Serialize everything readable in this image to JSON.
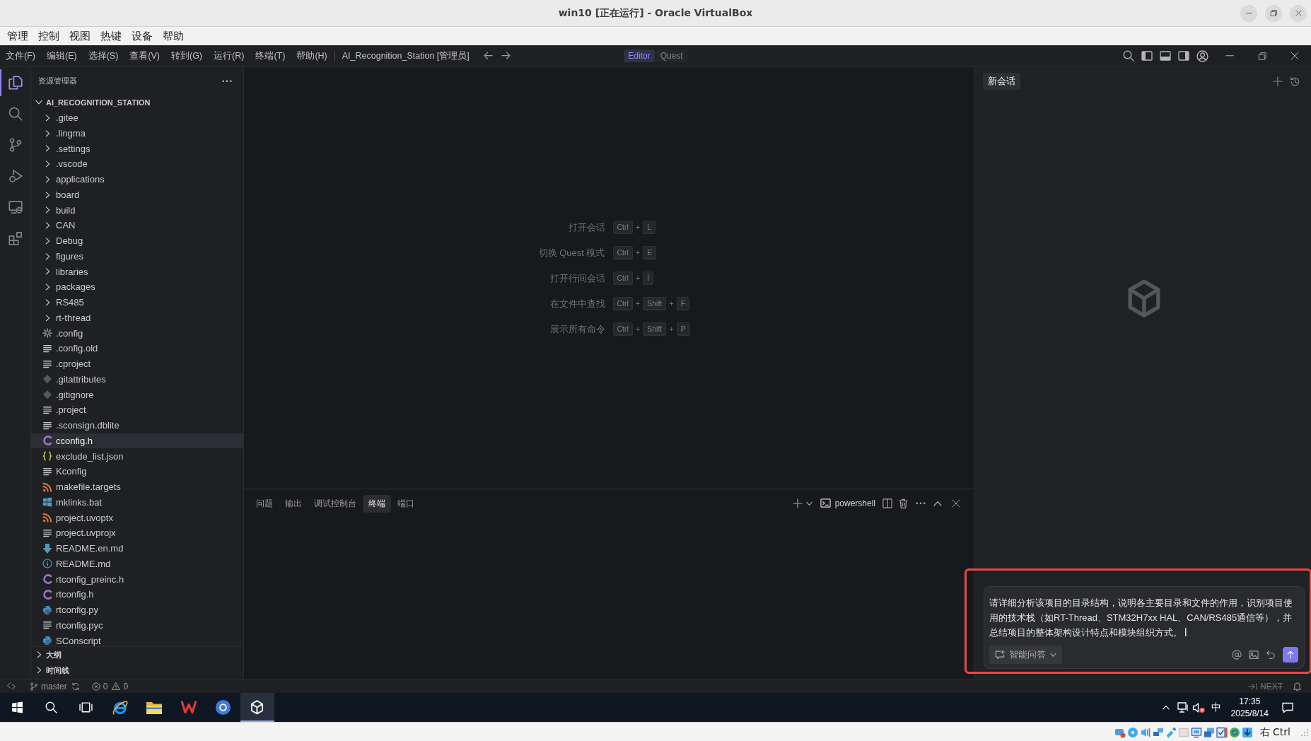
{
  "virtualbox": {
    "title": "win10 [正在运行] - Oracle VirtualBox",
    "menu": [
      "管理",
      "控制",
      "视图",
      "热键",
      "设备",
      "帮助"
    ],
    "host_key": "右 Ctrl"
  },
  "titlebar": {
    "menu": [
      "文件(F)",
      "编辑(E)",
      "选择(S)",
      "查看(V)",
      "转到(G)",
      "运行(R)",
      "终端(T)",
      "帮助(H)"
    ],
    "workspace": "AI_Recognition_Station [管理员]",
    "modes": [
      {
        "label": "Editor",
        "selected": true
      },
      {
        "label": "Quest",
        "selected": false
      }
    ]
  },
  "activity_bar": [
    {
      "kind": "explorer",
      "selected": true
    },
    {
      "kind": "search",
      "selected": false
    },
    {
      "kind": "source_control",
      "selected": false
    },
    {
      "kind": "run_debug",
      "selected": false
    },
    {
      "kind": "remote",
      "selected": false
    },
    {
      "kind": "extensions",
      "selected": false
    }
  ],
  "sidebar": {
    "title": "资源管理器",
    "root": {
      "label": "AI_RECOGNITION_STATION",
      "expanded": true
    },
    "folders": [
      {
        "label": ".gitee",
        "expanded": false,
        "selected": false
      },
      {
        "label": ".lingma",
        "expanded": false,
        "selected": false
      },
      {
        "label": ".settings",
        "expanded": false,
        "selected": false
      },
      {
        "label": ".vscode",
        "expanded": false,
        "selected": false
      },
      {
        "label": "applications",
        "expanded": false,
        "selected": false
      },
      {
        "label": "board",
        "expanded": false,
        "selected": false
      },
      {
        "label": "build",
        "expanded": false,
        "selected": false
      },
      {
        "label": "CAN",
        "expanded": false,
        "selected": false
      },
      {
        "label": "Debug",
        "expanded": false,
        "selected": false
      },
      {
        "label": "figures",
        "expanded": false,
        "selected": false
      },
      {
        "label": "libraries",
        "expanded": false,
        "selected": false
      },
      {
        "label": "packages",
        "expanded": false,
        "selected": false
      },
      {
        "label": "RS485",
        "expanded": false,
        "selected": false
      },
      {
        "label": "rt-thread",
        "expanded": false,
        "selected": false
      }
    ],
    "files": [
      {
        "label": ".config",
        "kind": "config",
        "selected": false
      },
      {
        "label": ".config.old",
        "kind": "text",
        "selected": false
      },
      {
        "label": ".cproject",
        "kind": "text",
        "selected": false
      },
      {
        "label": ".gitattributes",
        "kind": "git",
        "selected": false
      },
      {
        "label": ".gitignore",
        "kind": "git",
        "selected": false
      },
      {
        "label": ".project",
        "kind": "text",
        "selected": false
      },
      {
        "label": ".sconsign.dblite",
        "kind": "text",
        "selected": false
      },
      {
        "label": "cconfig.h",
        "kind": "c",
        "selected": true
      },
      {
        "label": "exclude_list.json",
        "kind": "json",
        "selected": false
      },
      {
        "label": "Kconfig",
        "kind": "text",
        "selected": false
      },
      {
        "label": "makefile.targets",
        "kind": "xml",
        "selected": false
      },
      {
        "label": "mklinks.bat",
        "kind": "batch",
        "selected": false
      },
      {
        "label": "project.uvoptx",
        "kind": "xml",
        "selected": false
      },
      {
        "label": "project.uvprojx",
        "kind": "text",
        "selected": false
      },
      {
        "label": "README.en.md",
        "kind": "markdown",
        "selected": false
      },
      {
        "label": "README.md",
        "kind": "readme",
        "selected": false
      },
      {
        "label": "rtconfig_preinc.h",
        "kind": "c",
        "selected": false
      },
      {
        "label": "rtconfig.h",
        "kind": "c",
        "selected": false
      },
      {
        "label": "rtconfig.py",
        "kind": "python",
        "selected": false
      },
      {
        "label": "rtconfig.pyc",
        "kind": "text",
        "selected": false
      },
      {
        "label": "SConscript",
        "kind": "python",
        "selected": false
      }
    ],
    "sections": [
      {
        "label": "大纲",
        "expanded": false
      },
      {
        "label": "时间线",
        "expanded": false
      }
    ]
  },
  "editor": {
    "shortcuts": [
      {
        "label": "打开会话",
        "keys": [
          "Ctrl",
          "+",
          "L"
        ]
      },
      {
        "label": "切换 Quest 模式",
        "keys": [
          "Ctrl",
          "+",
          "E"
        ]
      },
      {
        "label": "打开行间会话",
        "keys": [
          "Ctrl",
          "+",
          "I"
        ]
      },
      {
        "label": "在文件中查找",
        "keys": [
          "Ctrl",
          "+",
          "Shift",
          "+",
          "F"
        ]
      },
      {
        "label": "展示所有命令",
        "keys": [
          "Ctrl",
          "+",
          "Shift",
          "+",
          "P"
        ]
      }
    ]
  },
  "panel": {
    "tabs": [
      {
        "label": "问题",
        "selected": false
      },
      {
        "label": "输出",
        "selected": false
      },
      {
        "label": "调试控制台",
        "selected": false
      },
      {
        "label": "终端",
        "selected": true
      },
      {
        "label": "端口",
        "selected": false
      }
    ],
    "terminal": "powershell"
  },
  "chat": {
    "tab": "新会话",
    "input": {
      "value": "请详细分析该项目的目录结构，说明各主要目录和文件的作用，识别项目使用的技术栈（如RT-Thread、STM32H7xx HAL、CAN/RS485通信等），并总结项目的整体架构设计特点和模块组织方式。",
      "mode": "智能问答",
      "highlighted": true
    }
  },
  "status_bar": {
    "branch": "master",
    "errors": "0",
    "warnings": "0",
    "next": "NEXT"
  },
  "taskbar": {
    "apps": [
      {
        "kind": "start",
        "active": false
      },
      {
        "kind": "search",
        "active": false
      },
      {
        "kind": "task_view",
        "active": false
      },
      {
        "kind": "ie",
        "active": false
      },
      {
        "kind": "explorer",
        "active": false
      },
      {
        "kind": "wps",
        "active": false
      },
      {
        "kind": "browser",
        "active": false
      },
      {
        "kind": "assistant",
        "active": true
      }
    ],
    "input_method": "中",
    "time": "17:35",
    "date": "2025/8/14"
  }
}
